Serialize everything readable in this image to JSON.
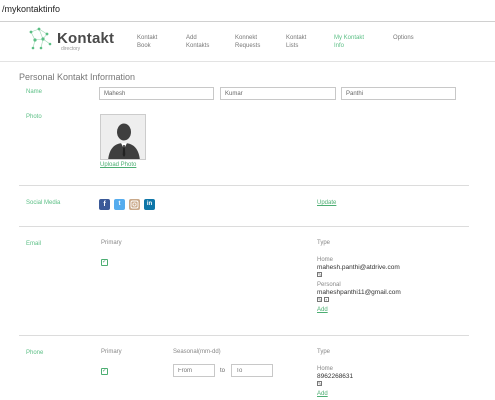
{
  "browser": {
    "url": "/mykontaktinfo"
  },
  "header": {
    "logo_text": "Kontakt",
    "logo_sub": "directory",
    "nav": [
      {
        "line1": "Kontakt",
        "line2": "Book"
      },
      {
        "line1": "Add",
        "line2": "Kontakts"
      },
      {
        "line1": "Konnekt",
        "line2": "Requests"
      },
      {
        "line1": "Kontakt",
        "line2": "Lists"
      },
      {
        "line1": "My Kontakt",
        "line2": "Info",
        "active": true
      },
      {
        "line1": "Options",
        "line2": ""
      }
    ]
  },
  "page": {
    "title": "Personal Kontakt Information"
  },
  "name_section": {
    "label": "Name",
    "first": "Mahesh",
    "middle": "Kumar",
    "last": "Panthi"
  },
  "photo_section": {
    "label": "Photo",
    "upload_label": "Upload Photo"
  },
  "social_section": {
    "label": "Social Media",
    "icons": [
      "facebook-icon",
      "twitter-icon",
      "instagram-icon",
      "linkedin-icon"
    ],
    "update_label": "Update"
  },
  "email_section": {
    "label": "Email",
    "primary_header": "Primary",
    "type_header": "Type",
    "entries": [
      {
        "kind": "Home",
        "value": "mahesh.panthi@atdrive.com"
      },
      {
        "kind": "Personal",
        "value": "maheshpanthi11@gmail.com"
      }
    ],
    "add_label": "Add"
  },
  "phone_section": {
    "label": "Phone",
    "primary_header": "Primary",
    "seasonal_header": "Seasonal(mm-dd)",
    "from_placeholder": "From",
    "to_text": "to",
    "to_placeholder": "To",
    "type_header": "Type",
    "entries": [
      {
        "kind": "Home",
        "value": "8962268631"
      }
    ],
    "add_label": "Add"
  },
  "colors": {
    "accent": "#5bbf85",
    "link": "#4cae72",
    "facebook": "#3b5998",
    "twitter": "#55acee",
    "instagram": "#c9a98a",
    "linkedin": "#0e76a8"
  }
}
